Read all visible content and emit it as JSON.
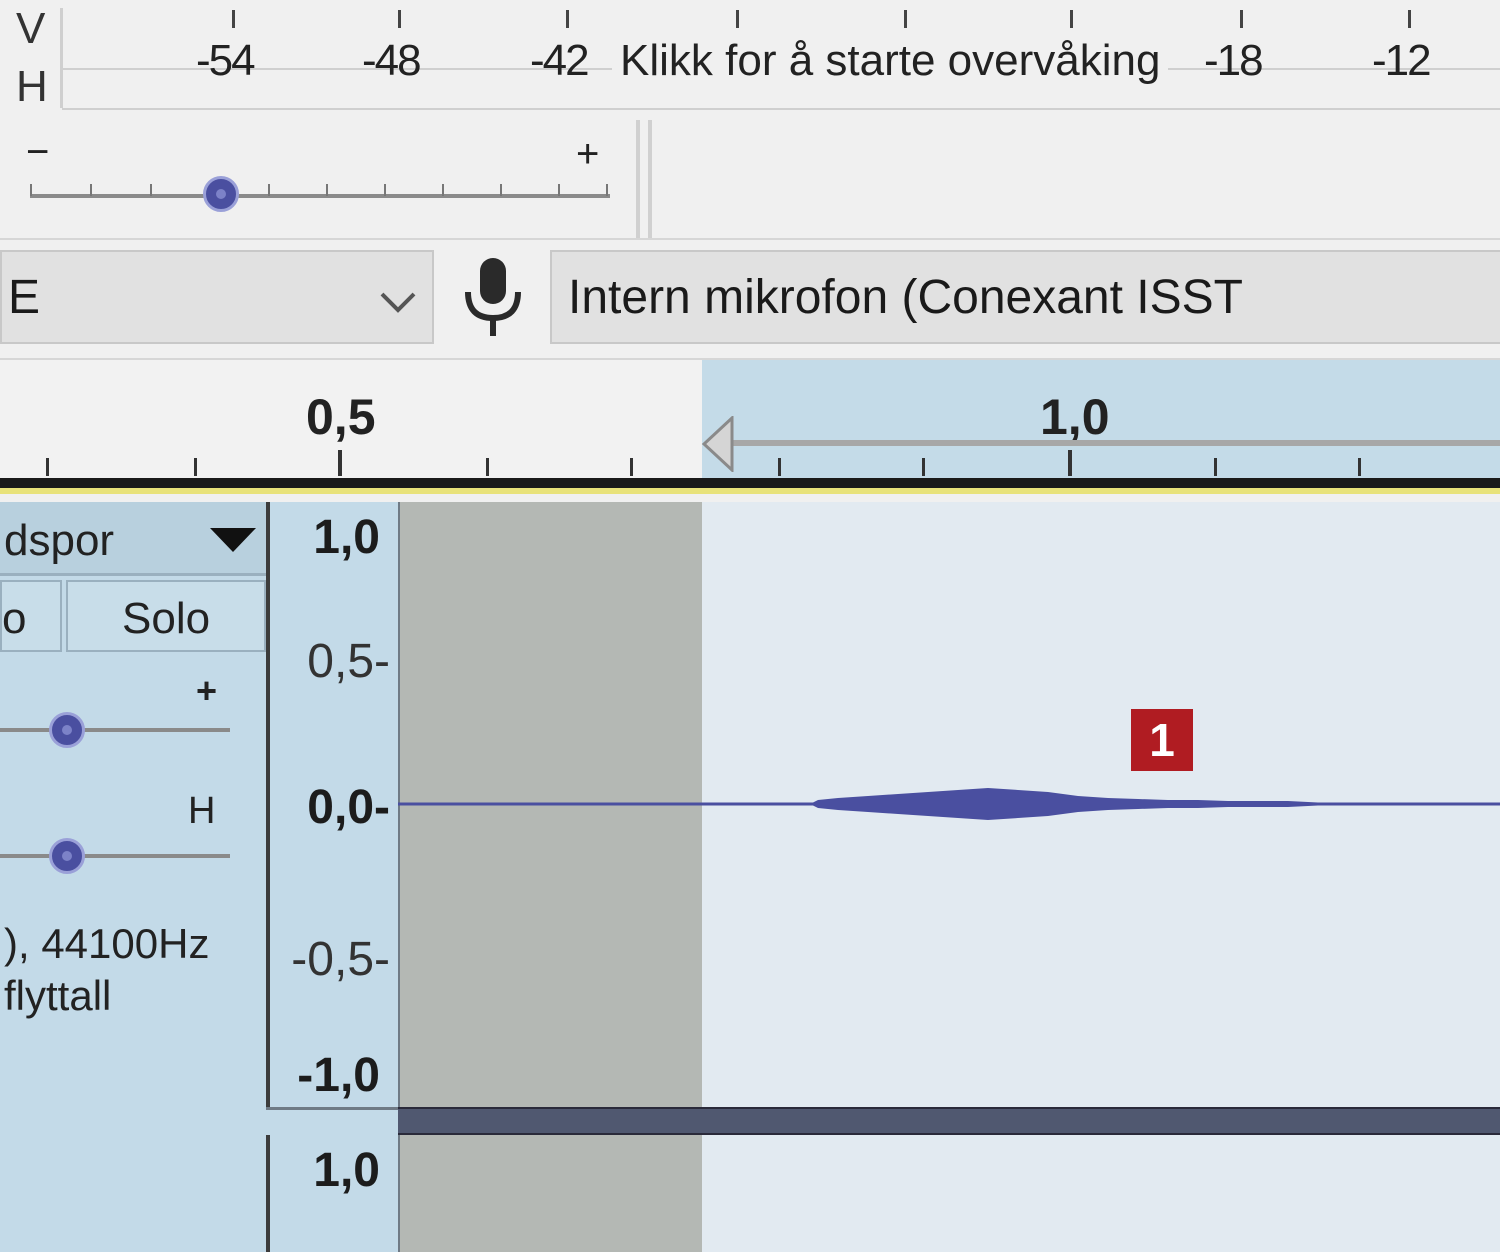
{
  "meter": {
    "vu_label_top": "V",
    "vu_label_bottom": "H",
    "ticks": [
      "-54",
      "-48",
      "-42",
      "-18",
      "-12"
    ],
    "monitor_prompt": "Klikk for å starte overvåking"
  },
  "volume": {
    "minus": "−",
    "plus": "+",
    "level": 0.33
  },
  "device": {
    "host_value": "E",
    "mic_icon": "microphone-icon",
    "input_device": "Intern mikrofon (Conexant ISST"
  },
  "ruler": {
    "labels": [
      "0,5",
      "1,0"
    ]
  },
  "track": {
    "name_partial": "dspor",
    "mute_partial": "o",
    "solo": "Solo",
    "gain_plus": "+",
    "pan_right": "H",
    "info_line1": "), 44100Hz",
    "info_line2": "flyttall",
    "gain_level": 0.3,
    "pan_level": 0.3
  },
  "amplitude": {
    "labels": [
      "1,0",
      "0,5-",
      "0,0-",
      "-0,5-",
      "-1,0"
    ],
    "labels_lower": [
      "1,0"
    ]
  },
  "badge": "1",
  "colors": {
    "waveform": "#4a4fa0",
    "selection": "#c4dbe8",
    "badge": "#b01c22"
  }
}
